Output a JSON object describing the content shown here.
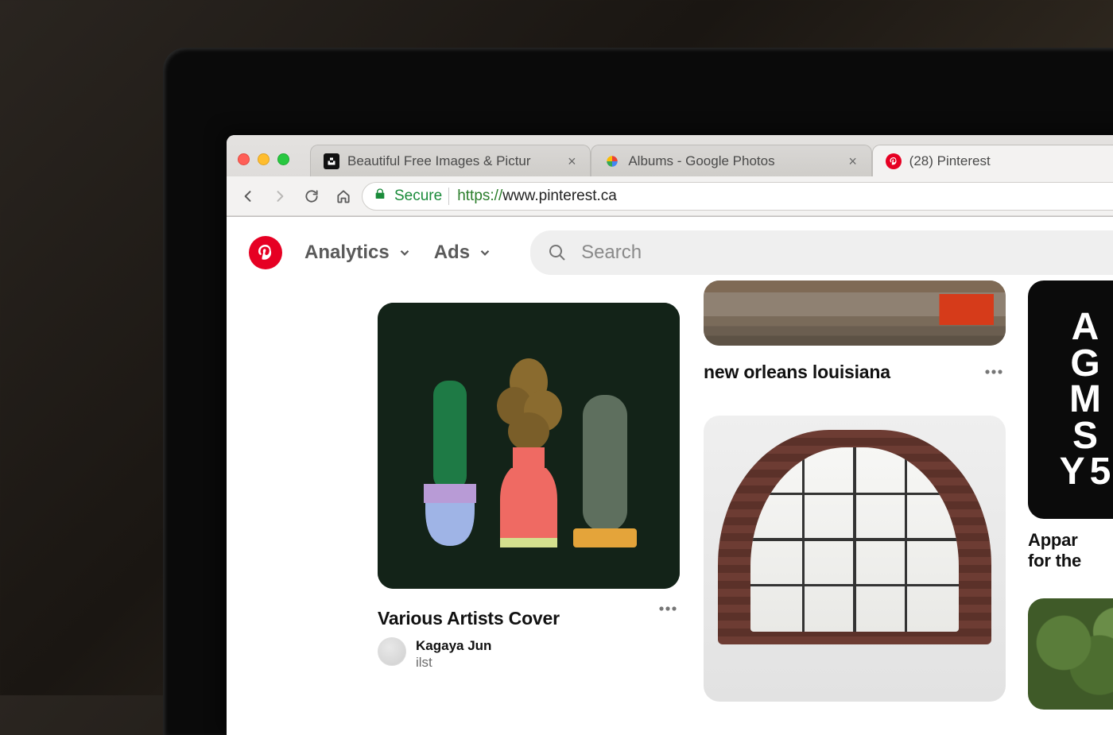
{
  "browser": {
    "tabs": [
      {
        "title": "Beautiful Free Images & Pictur",
        "favicon": "unsplash"
      },
      {
        "title": "Albums - Google Photos",
        "favicon": "gphotos"
      },
      {
        "title": "(28) Pinterest",
        "favicon": "pinterest",
        "active": true
      }
    ],
    "secure_label": "Secure",
    "url_scheme": "https://",
    "url_host": "www.pinterest.ca"
  },
  "header": {
    "nav": [
      {
        "label": "Analytics"
      },
      {
        "label": "Ads"
      }
    ],
    "search_placeholder": "Search"
  },
  "pins": {
    "p1": {
      "title": "Various Artists Cover",
      "author_name": "Kagaya Jun",
      "author_sub": "ilst"
    },
    "p2": {
      "title": "new orleans louisiana"
    },
    "p4": {
      "glyphs": [
        "A",
        "G",
        "M",
        "S",
        "Y5"
      ],
      "title": "Appar",
      "title_line2": "for the"
    }
  }
}
